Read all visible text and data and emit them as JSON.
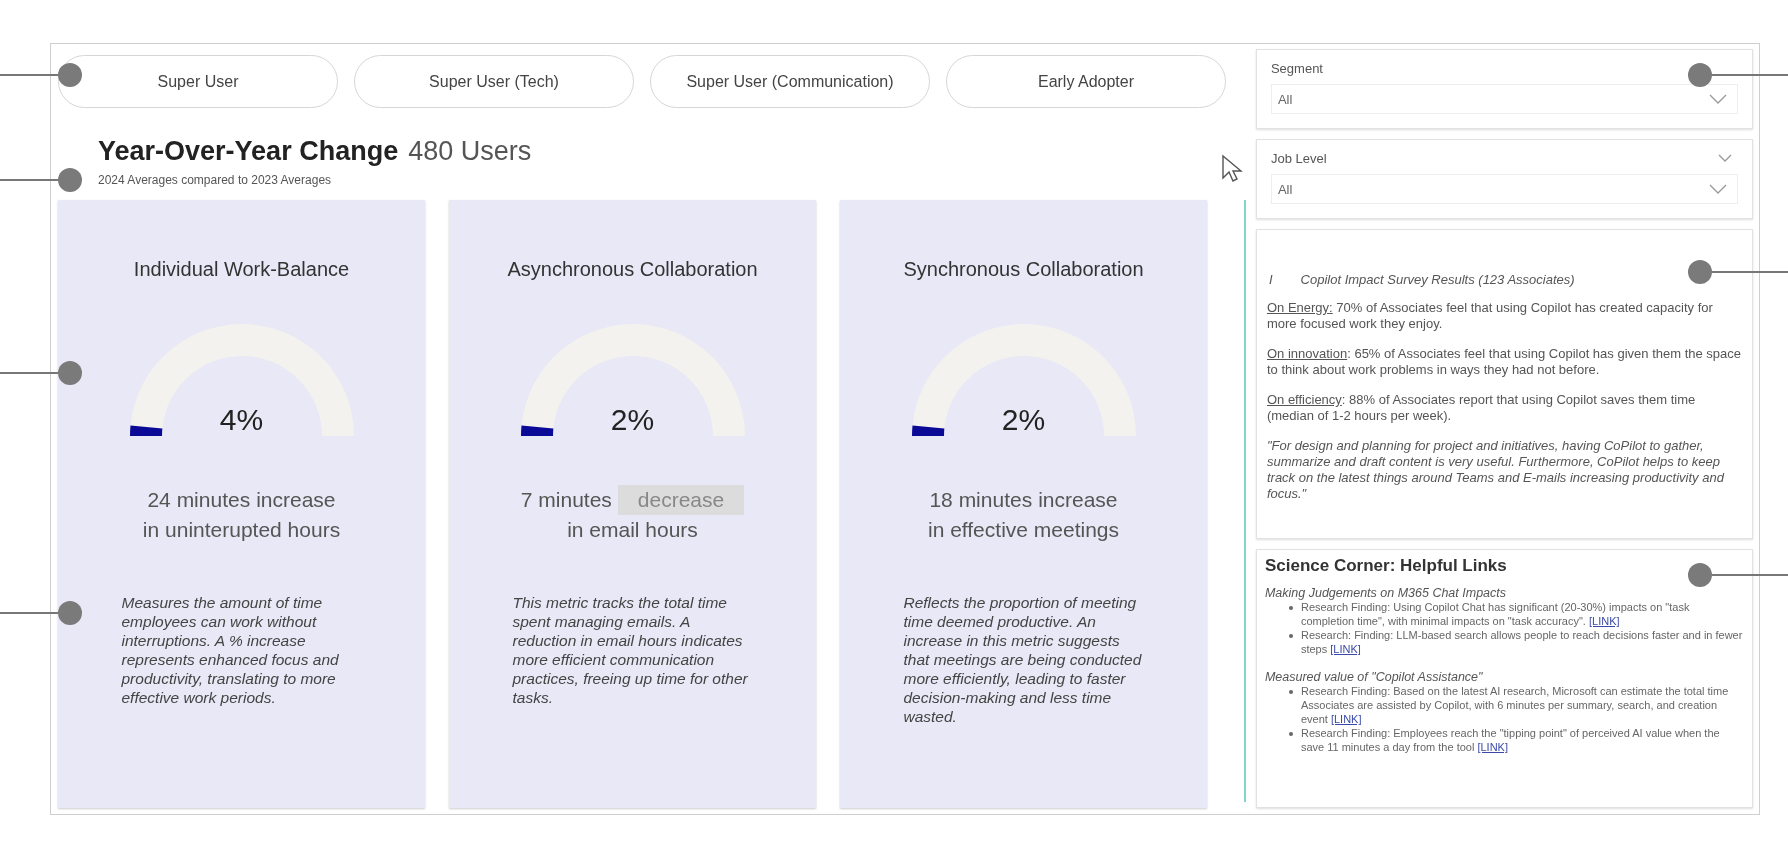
{
  "segments": [
    {
      "label": "Super User",
      "selected": false
    },
    {
      "label": "Super User (Tech)",
      "selected": false
    },
    {
      "label": "Super User (Communication)",
      "selected": false
    },
    {
      "label": "Early Adopter",
      "selected": false
    }
  ],
  "header": {
    "title": "Year-Over-Year Change",
    "count": "480 Users",
    "subtitle": "2024 Averages compared to 2023 Averages"
  },
  "metrics": [
    {
      "title": "Individual Work-Balance",
      "percent": "4%",
      "change": "24 minutes",
      "direction": "increase",
      "highlighted": false,
      "detail": "in uninterupted hours",
      "description": "Measures the amount of time employees can work without interruptions. A % increase represents enhanced focus and productivity, translating to more effective work periods."
    },
    {
      "title": "Asynchronous Collaboration",
      "percent": "2%",
      "change": "7 minutes",
      "direction": "decrease",
      "highlighted": true,
      "detail": "in email hours",
      "description": "This metric tracks the total time spent managing emails. A reduction in email hours indicates more efficient communication practices, freeing up time for other tasks."
    },
    {
      "title": "Synchronous Collaboration",
      "percent": "2%",
      "change": "18 minutes",
      "direction": "increase",
      "highlighted": false,
      "detail": "in effective meetings",
      "description": "Reflects the proportion of meeting time deemed productive. An increase in this metric suggests that meetings are being conducted more efficiently, leading to faster decision-making and less time wasted."
    }
  ],
  "filters": [
    {
      "label": "Segment",
      "value": "All",
      "collapsible": false
    },
    {
      "label": "Job Level",
      "value": "All",
      "collapsible": true
    }
  ],
  "survey": {
    "marker": "I",
    "title": "Copilot Impact Survey Results (123 Associates)",
    "paragraphs": [
      {
        "kind": "finding",
        "lead": "On Energy:",
        "text": " 70% of Associates feel that using Copilot has created capacity for more focused work they enjoy."
      },
      {
        "kind": "finding",
        "lead": "On innovation",
        "text": ": 65% of Associates feel that using Copilot has given them the space to think about work problems in ways they had not before."
      },
      {
        "kind": "finding",
        "lead": "On efficiency",
        "text": ": 88% of Associates report that using Copilot saves them time (median of 1-2 hours per week)."
      },
      {
        "kind": "quote",
        "text": "\"For design and planning for project and initiatives, having CoPilot to gather, summarize and draft content is very useful. Furthermore, CoPilot helps to keep track on the latest things around Teams and E-mails increasing productivity and focus.\""
      }
    ]
  },
  "science": {
    "title": "Science Corner: Helpful Links",
    "groups": [
      {
        "heading": "Making Judgements on M365 Chat Impacts",
        "items": [
          {
            "text": "Research Finding: Using Copilot Chat has significant (20-30%) impacts on \"task completion time\", with minimal impacts on \"task accuracy\".",
            "link": "[LINK]"
          },
          {
            "text": "Research: Finding: LLM-based search allows people to reach decisions faster and in fewer steps",
            "link": "[LINK]"
          }
        ]
      },
      {
        "heading": "Measured value of \"Copilot Assistance\"",
        "items": [
          {
            "text": "Research Finding: Based on the latest AI research, Microsoft can estimate the total time Associates are assisted by Copilot, with 6 minutes per summary, search, and creation event",
            "link": "[LINK]"
          },
          {
            "text": "Research Finding: Employees reach the \"tipping point\" of perceived AI value when the save 11 minutes a day from the tool",
            "link": "[LINK]"
          }
        ]
      }
    ]
  }
}
